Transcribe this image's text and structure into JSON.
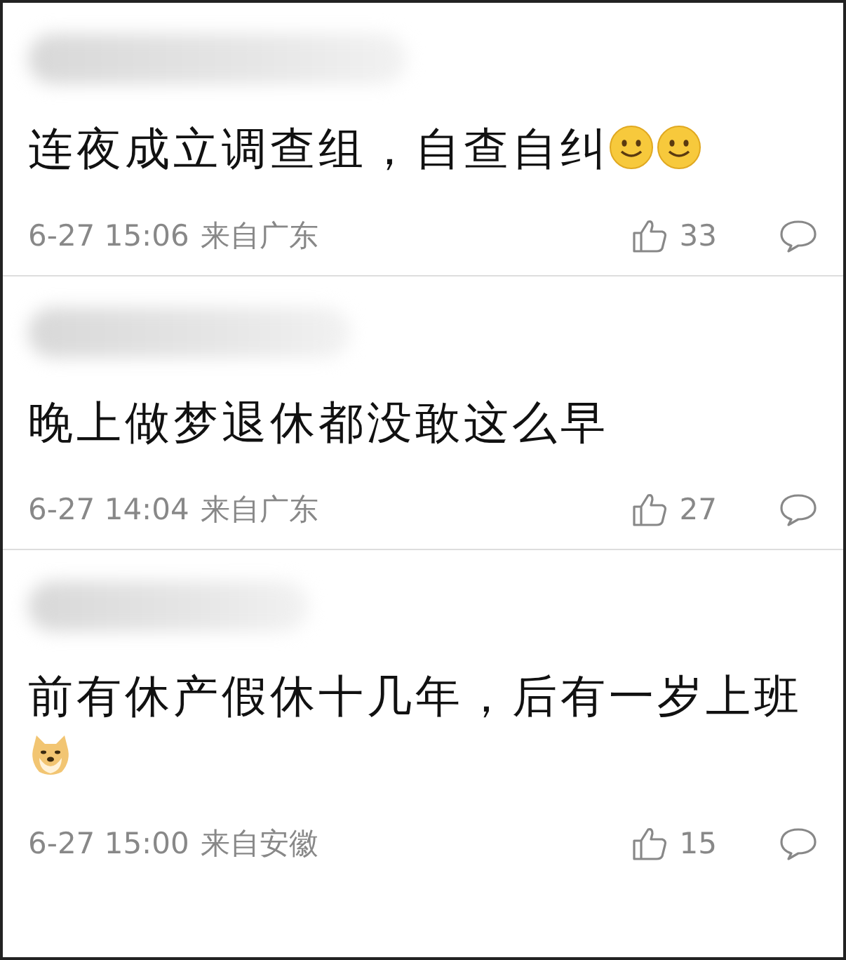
{
  "comments": [
    {
      "text": "连夜成立调查组，自查自纠",
      "emojis": [
        {
          "kind": "smile"
        },
        {
          "kind": "smile"
        }
      ],
      "time": "6-27 15:06",
      "location": "来自广东",
      "likes": "33"
    },
    {
      "text": "晚上做梦退休都没敢这么早",
      "time": "6-27 14:04",
      "location": "来自广东",
      "likes": "27"
    },
    {
      "text": "前有休产假休十几年，后有一岁上班",
      "emojis": [
        {
          "kind": "doge"
        }
      ],
      "time": "6-27 15:00",
      "location": "来自安徽",
      "likes": "15"
    }
  ]
}
